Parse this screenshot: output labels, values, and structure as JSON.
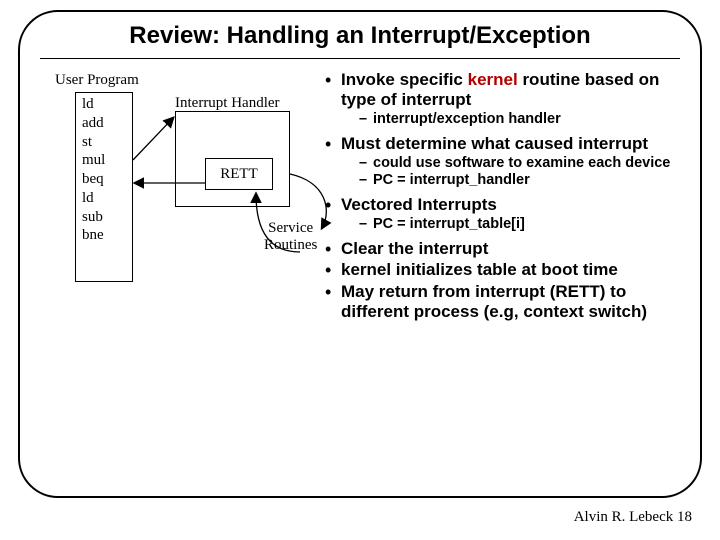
{
  "title": "Review: Handling an Interrupt/Exception",
  "diagram": {
    "user_program_label": "User Program",
    "interrupt_handler_label": "Interrupt Handler",
    "rett_label": "RETT",
    "service_routines_label_l1": "Service",
    "service_routines_label_l2": "Routines",
    "instructions": [
      "ld",
      "add",
      "st",
      "mul",
      "beq",
      "ld",
      "sub",
      "bne"
    ]
  },
  "bullets": {
    "b1_pre": "Invoke specific ",
    "b1_kernel": "kernel",
    "b1_post": " routine based on type of interrupt",
    "b1_sub1": "interrupt/exception handler",
    "b2": "Must determine what caused interrupt",
    "b2_sub1": "could use software to examine each device",
    "b2_sub2": "PC = interrupt_handler",
    "b3": "Vectored Interrupts",
    "b3_sub1": "PC = interrupt_table[i]",
    "b4": "Clear the interrupt",
    "b5": "kernel initializes table at boot time",
    "b6": "May return from interrupt (RETT) to different process (e.g, context switch)"
  },
  "footer": "Alvin R. Lebeck 18"
}
